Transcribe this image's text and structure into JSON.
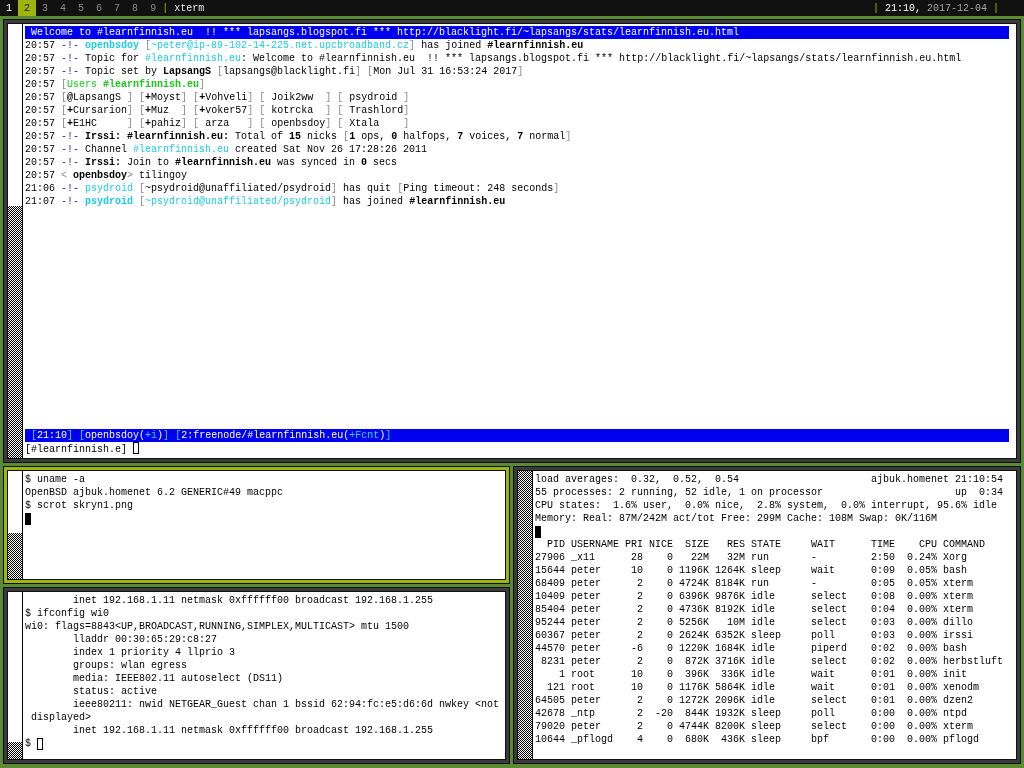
{
  "top_bar": {
    "tags": [
      {
        "label": "1",
        "selected": false,
        "occupied": true
      },
      {
        "label": "2",
        "selected": true,
        "occupied": true
      },
      {
        "label": "3",
        "selected": false,
        "occupied": false
      },
      {
        "label": "4",
        "selected": false,
        "occupied": false
      },
      {
        "label": "5",
        "selected": false,
        "occupied": false
      },
      {
        "label": "6",
        "selected": false,
        "occupied": false
      },
      {
        "label": "7",
        "selected": false,
        "occupied": false
      },
      {
        "label": "8",
        "selected": false,
        "occupied": false
      },
      {
        "label": "9",
        "selected": false,
        "occupied": false
      }
    ],
    "divider": "|",
    "window_title": "xterm",
    "clock_dividers": [
      "|",
      "|"
    ],
    "clock": {
      "time": "21:10,",
      "date": "2017-12-04"
    }
  },
  "windows": [
    {
      "kind": "irc",
      "focused": false,
      "topic": "Welcome to #learnfinnish.eu  !! *** lapsangs.blogspot.fi *** http://blacklight.fi/~lapsangs/stats/learnfinnish.eu.html",
      "messages": [
        {
          "time": "20:57",
          "parts": [
            {
              "text": "-!- ",
              "kind": "marker"
            },
            {
              "text": "openbsdoy ",
              "kind": "nick"
            },
            {
              "text": "[",
              "kind": "dim"
            },
            {
              "text": "~peter@ip-89-102-14-225.net.upcbroadband.cz",
              "kind": "cyan"
            },
            {
              "text": "]",
              "kind": "dim"
            },
            {
              "text": " has joined "
            },
            {
              "text": "#learnfinnish.eu",
              "kind": "bold"
            }
          ]
        },
        {
          "time": "20:57",
          "parts": [
            {
              "text": "-!- ",
              "kind": "marker"
            },
            {
              "text": "Topic for "
            },
            {
              "text": "#learnfinnish.eu",
              "kind": "cyan"
            },
            {
              "text": ": Welcome to #learnfinnish.eu  !! *** lapsangs.blogspot.fi *** http://blacklight.fi/~lapsangs/stats/learnfinnish.eu.html"
            }
          ]
        },
        {
          "time": "20:57",
          "parts": [
            {
              "text": "-!- ",
              "kind": "marker"
            },
            {
              "text": "Topic set by "
            },
            {
              "text": "LapsangS ",
              "kind": "bold"
            },
            {
              "text": "[",
              "kind": "dim"
            },
            {
              "text": "lapsangs@blacklight.fi"
            },
            {
              "text": "] [",
              "kind": "dim"
            },
            {
              "text": "Mon Jul 31 16:53:24 2017"
            },
            {
              "text": "]",
              "kind": "dim"
            }
          ]
        },
        {
          "time": "20:57",
          "parts": [
            {
              "text": "[",
              "kind": "dim"
            },
            {
              "text": "Users ",
              "kind": "green"
            },
            {
              "text": "#learnfinnish.eu",
              "kind": "green_bold"
            },
            {
              "text": "]",
              "kind": "dim"
            }
          ]
        },
        {
          "time": "20:57",
          "parts": [
            {
              "text": "[",
              "kind": "dim"
            },
            {
              "text": "@",
              "kind": "bold"
            },
            {
              "text": "LapsangS "
            },
            {
              "text": "] [",
              "kind": "dim"
            },
            {
              "text": "+",
              "kind": "bold"
            },
            {
              "text": "Moyst"
            },
            {
              "text": "] [",
              "kind": "dim"
            },
            {
              "text": "+",
              "kind": "bold"
            },
            {
              "text": "Vohveli"
            },
            {
              "text": "] [",
              "kind": "dim"
            },
            {
              "text": " Joik2ww  "
            },
            {
              "text": "] [",
              "kind": "dim"
            },
            {
              "text": " psydroid "
            },
            {
              "text": "]",
              "kind": "dim"
            }
          ]
        },
        {
          "time": "20:57",
          "parts": [
            {
              "text": "[",
              "kind": "dim"
            },
            {
              "text": "+",
              "kind": "bold"
            },
            {
              "text": "Cursarion"
            },
            {
              "text": "] [",
              "kind": "dim"
            },
            {
              "text": "+",
              "kind": "bold"
            },
            {
              "text": "Muz  "
            },
            {
              "text": "] [",
              "kind": "dim"
            },
            {
              "text": "+",
              "kind": "bold"
            },
            {
              "text": "voker57"
            },
            {
              "text": "] [",
              "kind": "dim"
            },
            {
              "text": " kotrcka  "
            },
            {
              "text": "] [",
              "kind": "dim"
            },
            {
              "text": " Trashlord"
            },
            {
              "text": "]",
              "kind": "dim"
            }
          ]
        },
        {
          "time": "20:57",
          "parts": [
            {
              "text": "[",
              "kind": "dim"
            },
            {
              "text": "+",
              "kind": "bold"
            },
            {
              "text": "E1HC     "
            },
            {
              "text": "] [",
              "kind": "dim"
            },
            {
              "text": "+",
              "kind": "bold"
            },
            {
              "text": "pahiz"
            },
            {
              "text": "] [",
              "kind": "dim"
            },
            {
              "text": " arza   "
            },
            {
              "text": "] [",
              "kind": "dim"
            },
            {
              "text": " openbsdoy"
            },
            {
              "text": "] [",
              "kind": "dim"
            },
            {
              "text": " Xtala    "
            },
            {
              "text": "]",
              "kind": "dim"
            }
          ]
        },
        {
          "time": "20:57",
          "parts": [
            {
              "text": "-!- ",
              "kind": "marker"
            },
            {
              "text": "Irssi: #learnfinnish.eu:",
              "kind": "bold"
            },
            {
              "text": " Total of "
            },
            {
              "text": "15",
              "kind": "bold"
            },
            {
              "text": " nicks "
            },
            {
              "text": "[",
              "kind": "dim"
            },
            {
              "text": "1",
              "kind": "bold"
            },
            {
              "text": " ops, "
            },
            {
              "text": "0",
              "kind": "bold"
            },
            {
              "text": " halfops, "
            },
            {
              "text": "7",
              "kind": "bold"
            },
            {
              "text": " voices, "
            },
            {
              "text": "7",
              "kind": "bold"
            },
            {
              "text": " normal"
            },
            {
              "text": "]",
              "kind": "dim"
            }
          ]
        },
        {
          "time": "20:57",
          "parts": [
            {
              "text": "-!- ",
              "kind": "marker"
            },
            {
              "text": "Channel "
            },
            {
              "text": "#learnfinnish.eu",
              "kind": "cyan"
            },
            {
              "text": " created Sat Nov 26 17:28:26 2011"
            }
          ]
        },
        {
          "time": "20:57",
          "parts": [
            {
              "text": "-!- ",
              "kind": "marker"
            },
            {
              "text": "Irssi:",
              "kind": "bold"
            },
            {
              "text": " Join to "
            },
            {
              "text": "#learnfinnish.eu",
              "kind": "bold"
            },
            {
              "text": " was synced in "
            },
            {
              "text": "0",
              "kind": "bold"
            },
            {
              "text": " secs"
            }
          ]
        },
        {
          "time": "20:57",
          "parts": [
            {
              "text": "<",
              "kind": "dim"
            },
            {
              "text": " openbsdoy",
              "kind": "bold"
            },
            {
              "text": ">",
              "kind": "dim"
            },
            {
              "text": " tilingoy"
            }
          ]
        },
        {
          "time": "21:06",
          "parts": [
            {
              "text": "-!- ",
              "kind": "marker"
            },
            {
              "text": "psydroid ",
              "kind": "cyan"
            },
            {
              "text": "[",
              "kind": "dim"
            },
            {
              "text": "~psydroid@unaffiliated/psydroid"
            },
            {
              "text": "]",
              "kind": "dim"
            },
            {
              "text": " has quit "
            },
            {
              "text": "[",
              "kind": "dim"
            },
            {
              "text": "Ping timeout: 248 seconds"
            },
            {
              "text": "]",
              "kind": "dim"
            }
          ]
        },
        {
          "time": "21:07",
          "parts": [
            {
              "text": "-!- ",
              "kind": "marker"
            },
            {
              "text": "psydroid ",
              "kind": "nick"
            },
            {
              "text": "[",
              "kind": "dim"
            },
            {
              "text": "~psydroid@unaffiliated/psydroid",
              "kind": "cyan"
            },
            {
              "text": "]",
              "kind": "dim"
            },
            {
              "text": " has joined "
            },
            {
              "text": "#learnfinnish.eu",
              "kind": "bold"
            }
          ]
        }
      ],
      "status_bar": [
        {
          "parts": [
            {
              "text": "[",
              "kind": "accent"
            },
            {
              "text": "21:10"
            },
            {
              "text": "]",
              "kind": "accent"
            }
          ]
        },
        {
          "parts": [
            {
              "text": "[",
              "kind": "accent"
            },
            {
              "text": "openbsdoy("
            },
            {
              "text": "+i",
              "kind": "accent"
            },
            {
              "text": ")"
            },
            {
              "text": "]",
              "kind": "accent"
            }
          ]
        },
        {
          "parts": [
            {
              "text": "[",
              "kind": "accent"
            },
            {
              "text": "2:freenode/#learnfinnish.eu("
            },
            {
              "text": "+Fcnt",
              "kind": "accent"
            },
            {
              "text": ")"
            },
            {
              "text": "]",
              "kind": "accent"
            }
          ]
        }
      ],
      "input": {
        "text": "[#learnfinnish.e]",
        "cursor_filled": false
      }
    },
    {
      "kind": "shell",
      "focused": true,
      "lines": [
        {
          "kind": "plain",
          "text": "$ uname -a"
        },
        {
          "kind": "plain",
          "text": "OpenBSD ajbuk.homenet 6.2 GENERIC#49 macppc"
        },
        {
          "kind": "plain",
          "text": "$ scrot skryn1.png"
        }
      ],
      "prompt": {
        "cursor_filled": true
      }
    },
    {
      "kind": "shell",
      "focused": false,
      "lines": [
        {
          "kind": "indented",
          "text": "inet 192.168.1.11 netmask 0xffffff00 broadcast 192.168.1.255"
        },
        {
          "kind": "plain",
          "text": "$ ifconfig wi0"
        },
        {
          "kind": "plain",
          "text": "wi0: flags=8843<UP,BROADCAST,RUNNING,SIMPLEX,MULTICAST> mtu 1500"
        },
        {
          "kind": "indented",
          "text": "lladdr 00:30:65:29:c8:27"
        },
        {
          "kind": "indented",
          "text": "index 1 priority 4 llprio 3"
        },
        {
          "kind": "indented",
          "text": "groups: wlan egress"
        },
        {
          "kind": "indented",
          "text": "media: IEEE802.11 autoselect (DS11)"
        },
        {
          "kind": "indented",
          "text": "status: active"
        },
        {
          "kind": "indented",
          "text": "ieee80211: nwid NETGEAR_Guest chan 1 bssid 62:94:fc:e5:d6:6d nwkey <not"
        },
        {
          "kind": "continuation",
          "text": "displayed>"
        },
        {
          "kind": "indented",
          "text": "inet 192.168.1.11 netmask 0xffffff00 broadcast 192.168.1.255"
        }
      ],
      "prompt": {
        "text": "$",
        "cursor_filled": false
      }
    },
    {
      "kind": "process_monitor",
      "focused": false,
      "summary": [
        {
          "text": "load averages:  0.32,  0.52,  0.54",
          "aside": "ajbuk.homenet 21:10:54"
        },
        {
          "text": "55 processes: 2 running, 52 idle, 1 on processor",
          "aside": "up  0:34"
        },
        {
          "text": "CPU states:  1.6% user,  0.0% nice,  2.8% system,  0.0% interrupt, 95.6% idle"
        },
        {
          "text": "Memory: Real: 87M/242M act/tot Free: 299M Cache: 108M Swap: 0K/116M"
        }
      ],
      "prompt": {
        "cursor_filled": true
      },
      "table": {
        "columns": [
          "PID",
          "USERNAME",
          "PRI",
          "NICE",
          "SIZE",
          "RES",
          "STATE",
          "WAIT",
          "TIME",
          "CPU",
          "COMMAND"
        ],
        "rows": [
          [
            "27906",
            "_x11",
            "28",
            "0",
            "22M",
            "32M",
            "run",
            "-",
            "2:50",
            "0.24%",
            "Xorg"
          ],
          [
            "15644",
            "peter",
            "10",
            "0",
            "1196K",
            "1264K",
            "sleep",
            "wait",
            "0:09",
            "0.05%",
            "bash"
          ],
          [
            "68409",
            "peter",
            "2",
            "0",
            "4724K",
            "8184K",
            "run",
            "-",
            "0:05",
            "0.05%",
            "xterm"
          ],
          [
            "10409",
            "peter",
            "2",
            "0",
            "6396K",
            "9876K",
            "idle",
            "select",
            "0:08",
            "0.00%",
            "xterm"
          ],
          [
            "85404",
            "peter",
            "2",
            "0",
            "4736K",
            "8192K",
            "idle",
            "select",
            "0:04",
            "0.00%",
            "xterm"
          ],
          [
            "95244",
            "peter",
            "2",
            "0",
            "5256K",
            "10M",
            "idle",
            "select",
            "0:03",
            "0.00%",
            "dillo"
          ],
          [
            "60367",
            "peter",
            "2",
            "0",
            "2624K",
            "6352K",
            "sleep",
            "poll",
            "0:03",
            "0.00%",
            "irssi"
          ],
          [
            "44570",
            "peter",
            "-6",
            "0",
            "1220K",
            "1684K",
            "idle",
            "piperd",
            "0:02",
            "0.00%",
            "bash"
          ],
          [
            "8231",
            "peter",
            "2",
            "0",
            "872K",
            "3716K",
            "idle",
            "select",
            "0:02",
            "0.00%",
            "herbstluft"
          ],
          [
            "1",
            "root",
            "10",
            "0",
            "396K",
            "336K",
            "idle",
            "wait",
            "0:01",
            "0.00%",
            "init"
          ],
          [
            "121",
            "root",
            "10",
            "0",
            "1176K",
            "5864K",
            "idle",
            "wait",
            "0:01",
            "0.00%",
            "xenodm"
          ],
          [
            "64505",
            "peter",
            "2",
            "0",
            "1272K",
            "2096K",
            "idle",
            "select",
            "0:01",
            "0.00%",
            "dzen2"
          ],
          [
            "42678",
            "_ntp",
            "2",
            "-20",
            "844K",
            "1932K",
            "sleep",
            "poll",
            "0:00",
            "0.00%",
            "ntpd"
          ],
          [
            "79020",
            "peter",
            "2",
            "0",
            "4744K",
            "8200K",
            "sleep",
            "select",
            "0:00",
            "0.00%",
            "xterm"
          ],
          [
            "10644",
            "_pflogd",
            "4",
            "0",
            "680K",
            "436K",
            "sleep",
            "bpf",
            "0:00",
            "0.00%",
            "pflogd"
          ]
        ]
      }
    }
  ]
}
